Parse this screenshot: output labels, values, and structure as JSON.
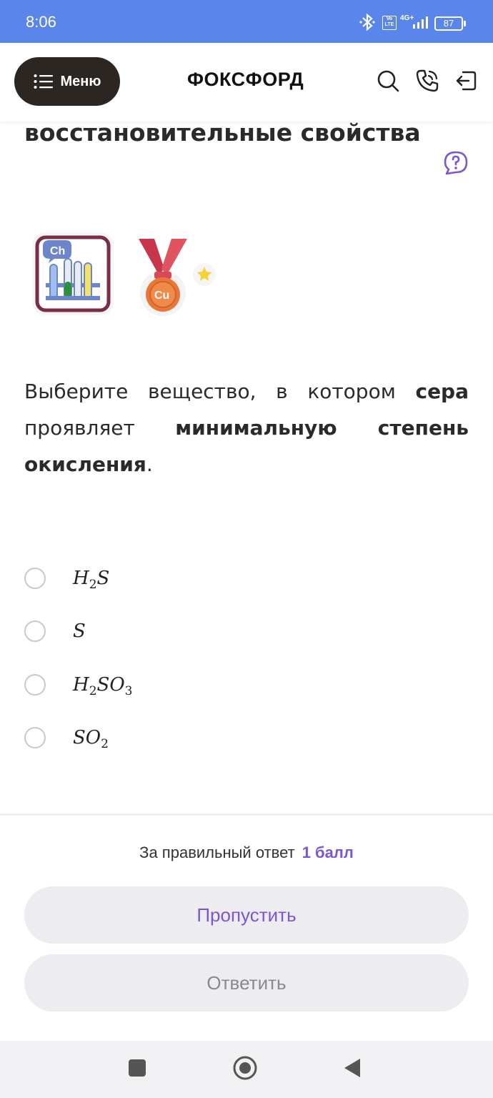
{
  "status_bar": {
    "time": "8:06",
    "volte": "Vo LTE",
    "network": "4G+",
    "battery": "87"
  },
  "header": {
    "menu_label": "Меню",
    "logo": "ФОКСФОРД"
  },
  "lesson": {
    "title": "восстановительные свойства"
  },
  "badges": [
    {
      "name": "chemistry-badge-icon",
      "text": "Ch"
    },
    {
      "name": "copper-medal-icon",
      "text": "Cu"
    }
  ],
  "question": {
    "part1": "Выберите вещество, в котором ",
    "bold1": "сера",
    "part2": " проявляет ",
    "bold2": "минимальную степень окисления",
    "part3": "."
  },
  "options": [
    {
      "main": "H",
      "sub": "2",
      "main2": "S",
      "sub2": ""
    },
    {
      "main": "S",
      "sub": "",
      "main2": "",
      "sub2": ""
    },
    {
      "main": "H",
      "sub": "2",
      "main2": "SO",
      "sub2": "3"
    },
    {
      "main": "SO",
      "sub": "2",
      "main2": "",
      "sub2": ""
    }
  ],
  "footer": {
    "reward_text": "За правильный ответ",
    "reward_points": "1 балл",
    "skip_label": "Пропустить",
    "answer_label": "Ответить"
  },
  "colors": {
    "status_bar": "#5a86ec",
    "accent": "#7b57d6",
    "menu_button": "#2c2623"
  }
}
